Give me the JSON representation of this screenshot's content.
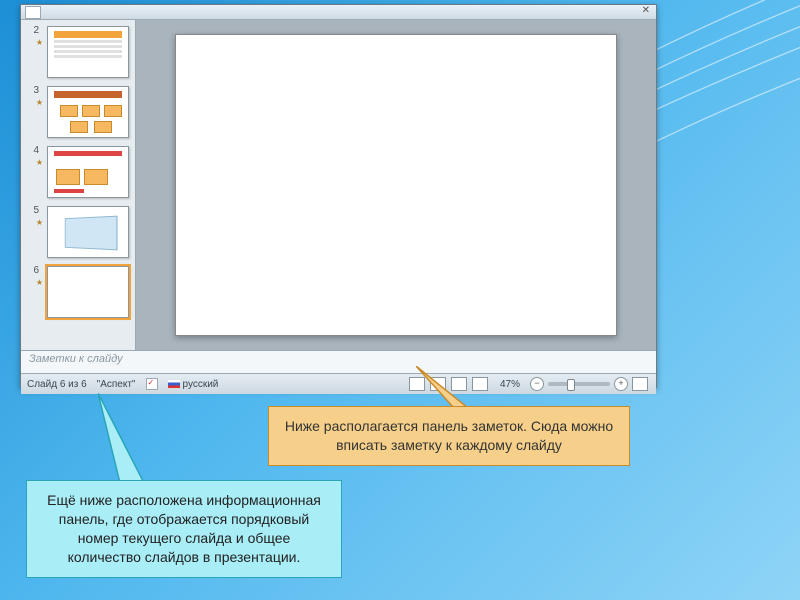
{
  "thumbs": {
    "items": [
      {
        "num": "2"
      },
      {
        "num": "3"
      },
      {
        "num": "4"
      },
      {
        "num": "5"
      },
      {
        "num": "6"
      }
    ]
  },
  "notes": {
    "placeholder": "Заметки к слайду"
  },
  "status": {
    "slide_counter": "Слайд 6 из 6",
    "theme": "\"Аспект\"",
    "language": "русский",
    "zoom_pct": "47%"
  },
  "callouts": {
    "orange": "Ниже располагается панель заметок. Сюда можно вписать заметку к каждому слайду",
    "cyan": "Ещё ниже расположена информационная панель, где отображается порядковый номер текущего слайда и общее количество слайдов в презентации."
  }
}
